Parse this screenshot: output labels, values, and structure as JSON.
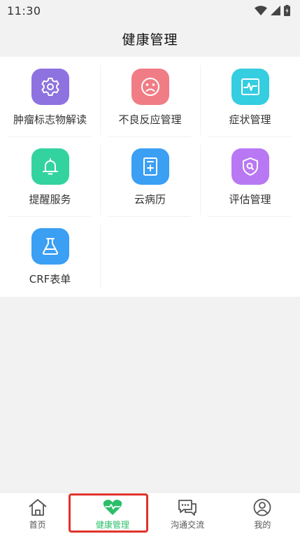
{
  "status_bar": {
    "time": "11:30"
  },
  "header": {
    "title": "健康管理"
  },
  "grid": {
    "items": [
      {
        "label": "肿瘤标志物解读",
        "icon": "gear-icon",
        "color": "#8e72e0"
      },
      {
        "label": "不良反应管理",
        "icon": "sad-face-icon",
        "color": "#f07d86"
      },
      {
        "label": "症状管理",
        "icon": "heartbeat-monitor-icon",
        "color": "#35cde0"
      },
      {
        "label": "提醒服务",
        "icon": "bell-icon",
        "color": "#33d3a0"
      },
      {
        "label": "云病历",
        "icon": "medical-record-icon",
        "color": "#3b9ff4"
      },
      {
        "label": "评估管理",
        "icon": "shield-search-icon",
        "color": "#b978f3"
      },
      {
        "label": "CRF表单",
        "icon": "flask-icon",
        "color": "#3b9ff4"
      }
    ]
  },
  "tabbar": {
    "tabs": [
      {
        "label": "首页",
        "icon": "home-icon",
        "active": false
      },
      {
        "label": "健康管理",
        "icon": "heart-icon",
        "active": true
      },
      {
        "label": "沟通交流",
        "icon": "chat-icon",
        "active": false
      },
      {
        "label": "我的",
        "icon": "user-icon",
        "active": false
      }
    ],
    "active_color": "#2bbf6a"
  }
}
